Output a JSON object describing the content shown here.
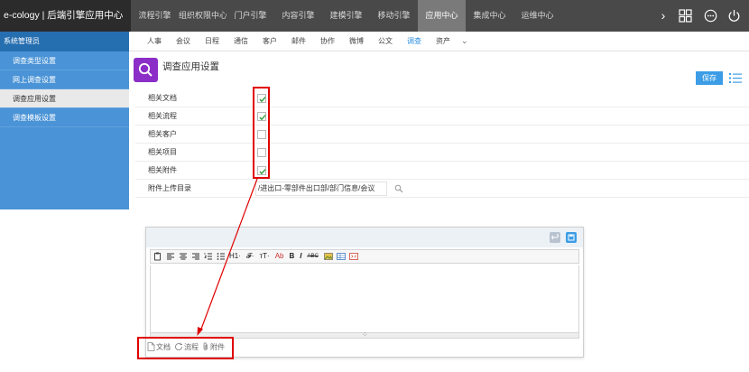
{
  "app": {
    "brand": "e-cology | 后端引擎应用中心"
  },
  "topnav": {
    "items": [
      "流程引擎",
      "组织权限中心",
      "门户引擎",
      "内容引擎",
      "建模引擎",
      "移动引擎",
      "应用中心",
      "集成中心",
      "运维中心"
    ],
    "active": "应用中心",
    "more_label": "›"
  },
  "sidebar": {
    "header": "系统管理员",
    "items": [
      "调查类型设置",
      "网上调查设置",
      "调查应用设置",
      "调查模板设置"
    ],
    "active": "调查应用设置"
  },
  "subnav": {
    "items": [
      "人事",
      "会议",
      "日程",
      "通信",
      "客户",
      "邮件",
      "协作",
      "微博",
      "公文",
      "调查",
      "资产"
    ],
    "active": "调查",
    "more_label": "⌄"
  },
  "page": {
    "title": "调查应用设置",
    "save_label": "保存"
  },
  "settings": {
    "rows": [
      {
        "label": "相关文档",
        "checked": true
      },
      {
        "label": "相关流程",
        "checked": true
      },
      {
        "label": "相关客户",
        "checked": false
      },
      {
        "label": "相关项目",
        "checked": false
      },
      {
        "label": "相关附件",
        "checked": true
      }
    ],
    "path_row": {
      "label": "附件上传目录",
      "value": "/进出口-零部件出口部/部门信息/会议"
    }
  },
  "editor": {
    "toolbar": {
      "h1": "H1·",
      "font": "𝓕·",
      "size": "тT·",
      "color": "Ab",
      "bold": "B",
      "italic": "I",
      "strike": "ABC"
    },
    "attachments": [
      "文档",
      "流程",
      "附件"
    ]
  },
  "colors": {
    "accent": "#3c9de6",
    "sidebar": "#4a93d6",
    "topbar": "#494949",
    "annotation": "#e00000",
    "page_icon": "#8b2ec7"
  }
}
